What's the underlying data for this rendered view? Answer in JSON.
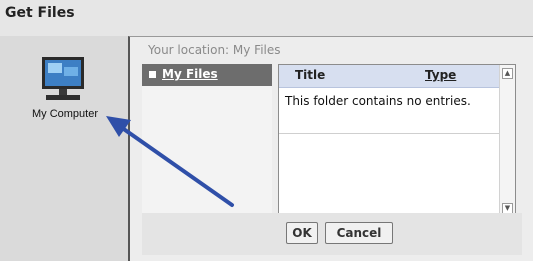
{
  "panel": {
    "title": "Get Files"
  },
  "desktop": {
    "computer_label": "My Computer"
  },
  "dialog": {
    "location": "Your location: My Files",
    "nav_items": [
      {
        "label": "My Files"
      }
    ],
    "columns": {
      "title": "Title",
      "type": "Type"
    },
    "empty_message": "This folder contains no entries.",
    "ok_label": "OK",
    "cancel_label": "Cancel"
  },
  "annotation": {
    "arrow_color": "#2f4fa8"
  }
}
